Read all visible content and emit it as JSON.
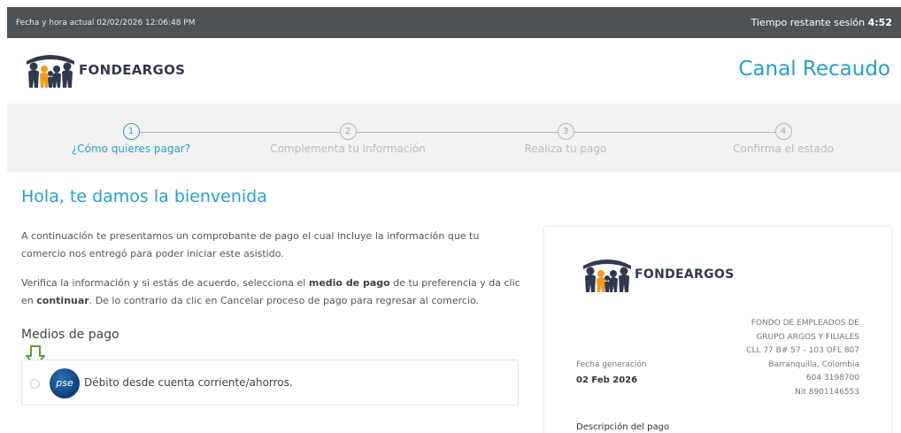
{
  "topbar": {
    "datetime": "Fecha y hora actual 02/02/2026 12:06:48 PM",
    "timer_label": "Tiempo restante sesión ",
    "timer_value": "4:52"
  },
  "brand": {
    "name": "FONDEARGOS",
    "channel": "Canal Recaudo"
  },
  "steps": [
    {
      "num": "1",
      "label": "¿Cómo quieres pagar?",
      "active": true
    },
    {
      "num": "2",
      "label": "Complementa tu información",
      "active": false
    },
    {
      "num": "3",
      "label": "Realiza tu pago",
      "active": false
    },
    {
      "num": "4",
      "label": "Confirma el estado",
      "active": false
    }
  ],
  "main": {
    "welcome": "Hola, te damos la bienvenida",
    "intro": "A continuación te presentamos un comprobante de pago el cual incluye la información que tu comercio nos entregó para poder iniciar este asistido.",
    "verify_1": "Verifica la información y si estás de acuerdo, selecciona el ",
    "verify_bold_1": "medio de pago",
    "verify_2": " de tu preferencia y da clic en ",
    "verify_bold_2": "continuar",
    "verify_3": ". De lo contrario da clic en Cancelar proceso de pago para regresar al comercio.",
    "payment_methods_title": "Medios de pago",
    "payment_option": {
      "logo_text": "pse",
      "label": "Débito desde cuenta corriente/ahorros."
    }
  },
  "receipt": {
    "brand": "FONDEARGOS",
    "address_lines": [
      "FONDO DE EMPLEADOS DE",
      "GRUPO ARGOS Y FILIALES",
      "CLL 77 B# 57 - 103 OFL 807",
      "Barranquilla, Colombia",
      "604 3198700",
      "Nit 8901146553"
    ],
    "date_label": "Fecha generación",
    "date_value": "02 Feb 2026",
    "description_label": "Descripción del pago"
  },
  "colors": {
    "accent": "#2a9fc4",
    "topbar": "#4d5257",
    "brand_dark": "#303a4e",
    "brand_orange": "#f39a1e",
    "arrow_green": "#5aa02c"
  },
  "icons": {
    "logo": "family-people-icon",
    "down_arrow": "down-arrow-icon",
    "pse": "pse-logo-icon"
  }
}
